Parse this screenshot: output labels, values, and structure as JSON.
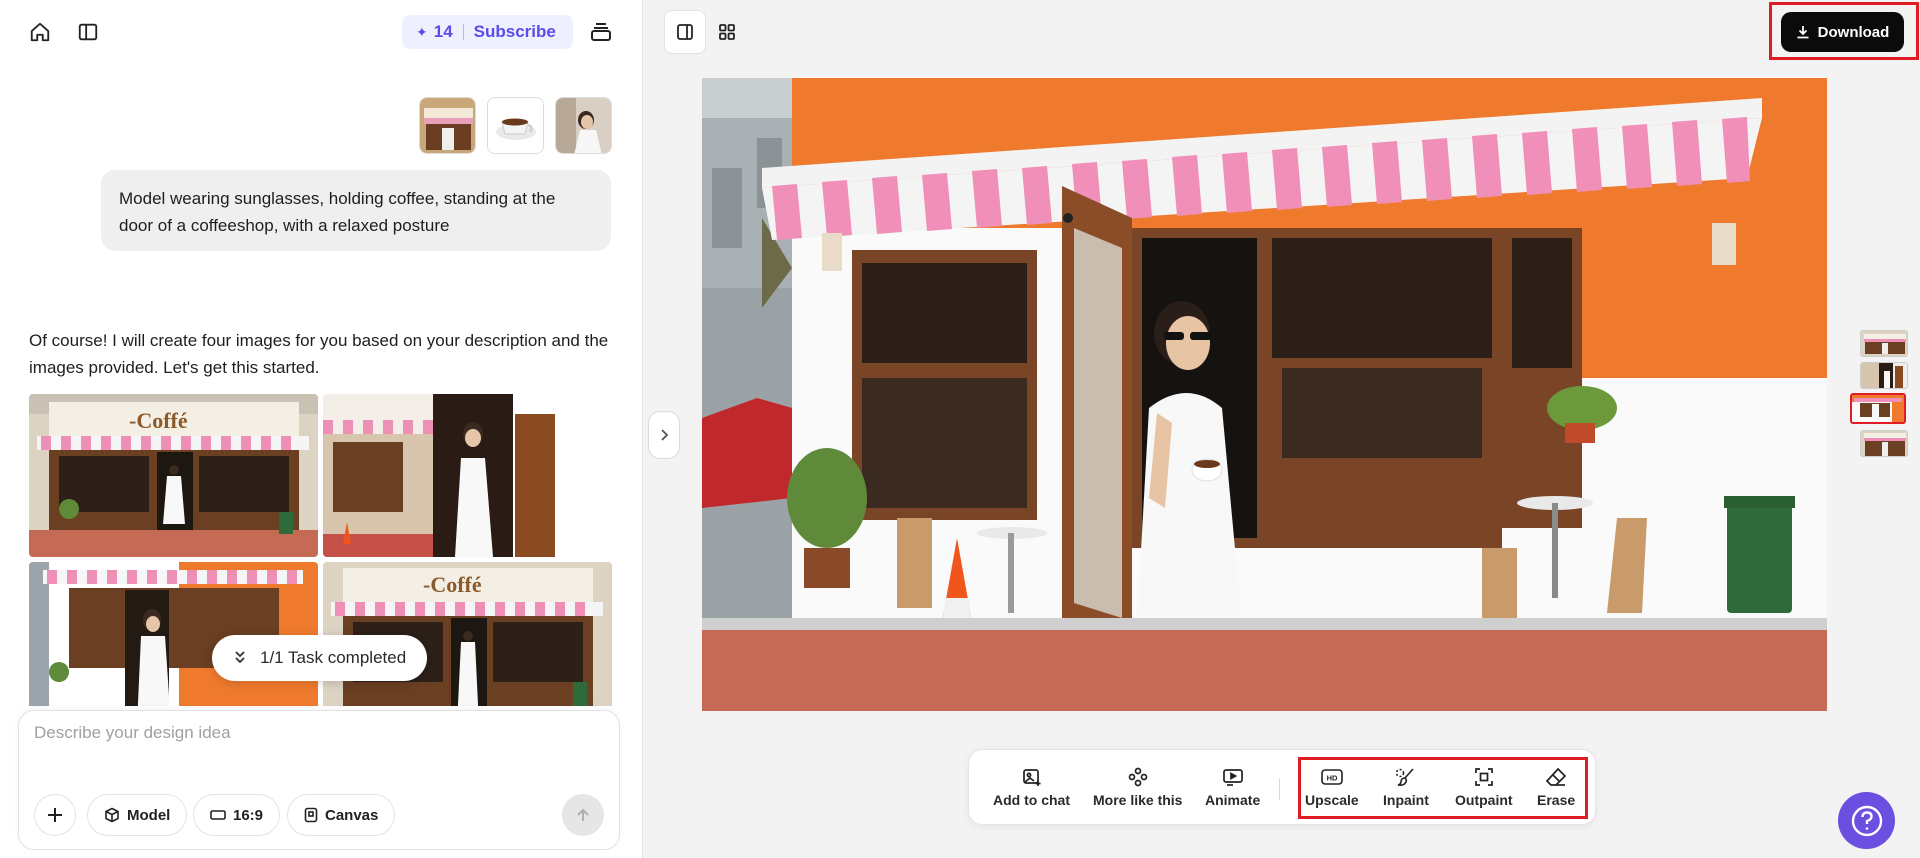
{
  "header": {
    "credits_count": "14",
    "subscribe_label": "Subscribe"
  },
  "chat": {
    "user_message": "Model wearing sunglasses, holding coffee, standing at the door of a coffeeshop, with a relaxed posture",
    "assistant_message": "Of course! I will create four images for you based on your description and the images provided. Let's get this started.",
    "task_status": "1/1 Task completed",
    "generated_images": [
      {
        "sign": "-Coffé"
      },
      {
        "sign": ""
      },
      {
        "sign": ""
      },
      {
        "sign": "-Coffé"
      }
    ]
  },
  "composer": {
    "placeholder": "Describe your design idea",
    "model_label": "Model",
    "ratio_label": "16:9",
    "canvas_label": "Canvas"
  },
  "canvas": {
    "download_label": "Download",
    "tools": [
      {
        "label": "Add to chat",
        "icon": "add-image-icon"
      },
      {
        "label": "More like this",
        "icon": "variations-icon"
      },
      {
        "label": "Animate",
        "icon": "animate-icon"
      },
      {
        "label": "Upscale",
        "icon": "hd-icon"
      },
      {
        "label": "Inpaint",
        "icon": "brush-icon"
      },
      {
        "label": "Outpaint",
        "icon": "expand-icon"
      },
      {
        "label": "Erase",
        "icon": "eraser-icon"
      }
    ],
    "tool_badge": "HD"
  },
  "colors": {
    "accent": "#5b4ce6",
    "highlight": "#e01d25",
    "help_button": "#6a4fe0",
    "awning_pink": "#f08fb8",
    "wall_orange": "#ef7a2e"
  }
}
